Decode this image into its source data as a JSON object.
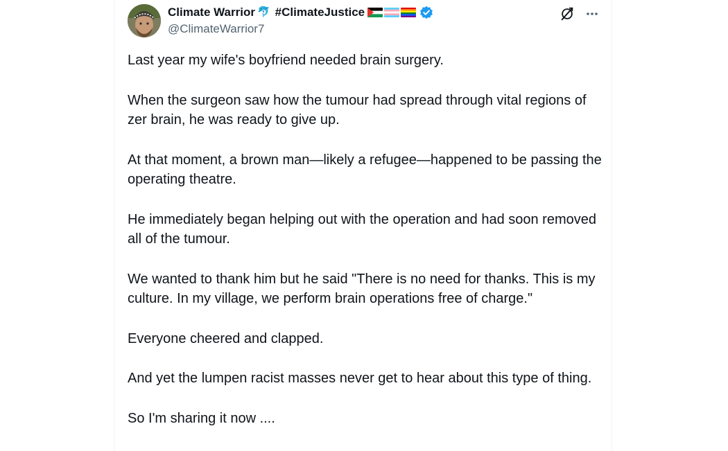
{
  "post": {
    "author": {
      "display_name": "Climate Warrior",
      "dolphin_emoji": "🐬",
      "hashtag": "#ClimateJustice",
      "handle": "@ClimateWarrior7",
      "verified_color": "#1d9bf0"
    },
    "icons": {
      "grok": "grok-icon",
      "more": "more-icon"
    },
    "paragraphs": [
      "Last year my wife's boyfriend needed brain surgery.",
      "When the surgeon saw how the tumour had spread through vital regions of zer brain, he was ready to give up.",
      "At that moment, a brown man—likely a refugee—happened to be passing the operating theatre.",
      "He immediately began helping out with the operation and had soon removed all of the tumour.",
      "We wanted to thank him but he said \"There is no need for thanks. This is my culture. In my village, we perform brain operations free of charge.\"",
      "Everyone cheered and clapped.",
      "And yet the lumpen racist masses never get to hear about this type of thing.",
      "So I'm sharing it now ...."
    ]
  }
}
